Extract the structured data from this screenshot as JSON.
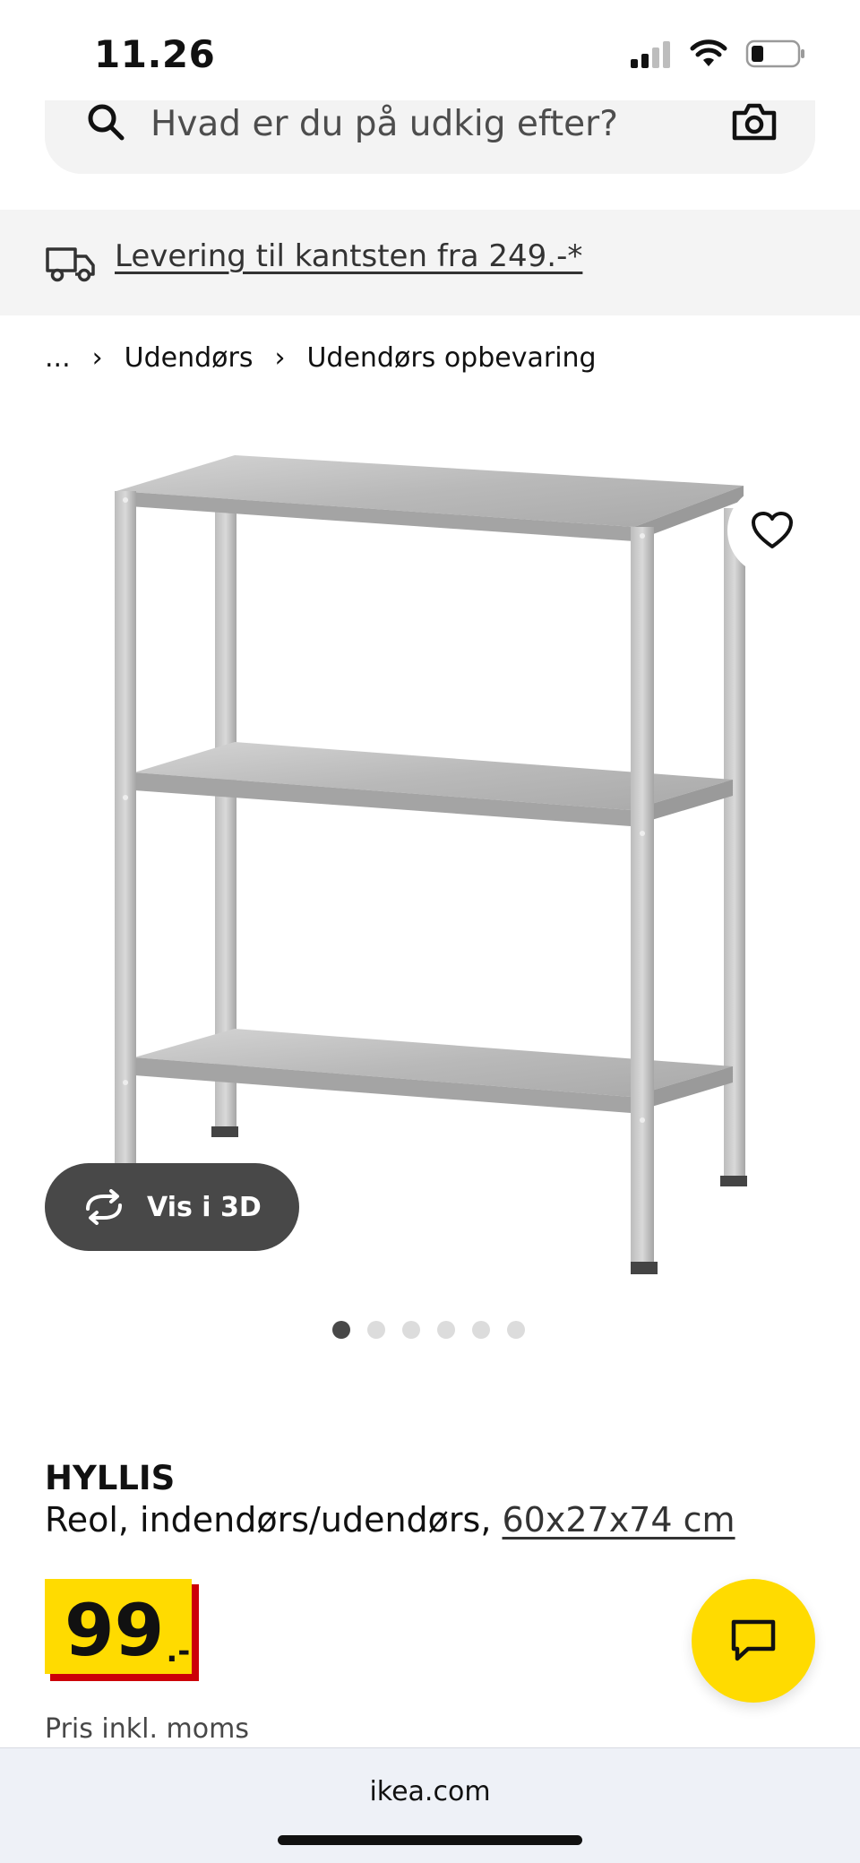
{
  "status_bar": {
    "time": "11.26",
    "icons": [
      "cellular-signal-icon",
      "wifi-icon",
      "battery-icon"
    ]
  },
  "search": {
    "placeholder": "Hvad er du på udkig efter?",
    "icons": [
      "search-icon",
      "camera-icon"
    ]
  },
  "delivery_banner": {
    "text": "Levering til kantsten fra 249.-*",
    "icon": "truck-icon"
  },
  "breadcrumb": {
    "items": [
      "...",
      "Udendørs",
      "Udendørs opbevaring"
    ],
    "separator": "›"
  },
  "gallery": {
    "favorite_icon": "heart-icon",
    "view_3d_label": "Vis i 3D",
    "view_3d_icon": "rotate-3d-icon",
    "dots_total": 6,
    "active_dot_index": 0
  },
  "product": {
    "name": "HYLLIS",
    "description": "Reol, indendørs/udendørs,",
    "size": "60x27x74 cm",
    "price_main": "99",
    "price_suffix": ".-",
    "price_note": "Pris inkl. moms"
  },
  "chat": {
    "icon": "chat-icon"
  },
  "browser": {
    "url": "ikea.com"
  },
  "colors": {
    "ikea_yellow": "#ffdb00",
    "price_shadow_red": "#cc0008",
    "dark_button": "#484848",
    "banner_background": "#f4f4f4"
  }
}
